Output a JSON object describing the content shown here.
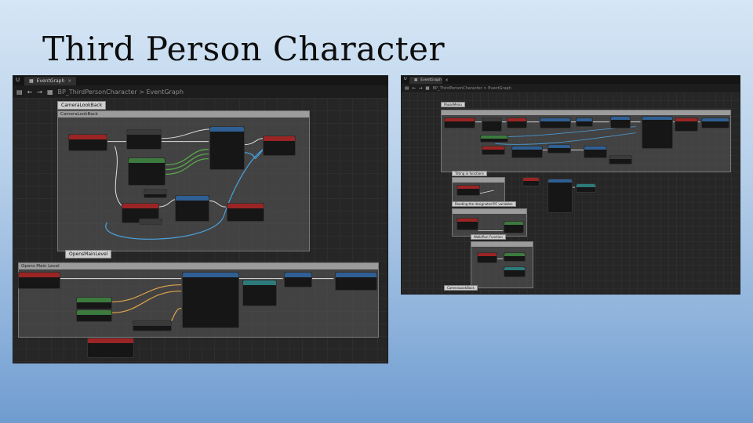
{
  "slide": {
    "title": "Third Person Character"
  },
  "left_editor": {
    "tab_title": "EventGraph",
    "breadcrumb_root": "BP_ThirdPersonCharacter",
    "breadcrumb_sep": ">",
    "breadcrumb_leaf": "EventGraph",
    "comments": [
      "CameraLookBack",
      "Opens Main Level"
    ],
    "tags": [
      "CameraLookBack",
      "OpensMainLevel"
    ],
    "colors": {
      "event": "#9b2424",
      "function": "#2f5f93",
      "pure": "#3c7a3e",
      "exec_wire": "#e8e8e8",
      "data_wire": "#4aa3df"
    }
  },
  "right_editor": {
    "tab_title": "EventGraph",
    "breadcrumb_root": "BP_ThirdPersonCharacter",
    "breadcrumb_sep": ">",
    "breadcrumb_leaf": "EventGraph",
    "tags": [
      "PauseMenu",
      "Tilting in functions",
      "Reading the designated PC variables",
      "Walk/Run Function",
      "CameraLookBack"
    ]
  }
}
